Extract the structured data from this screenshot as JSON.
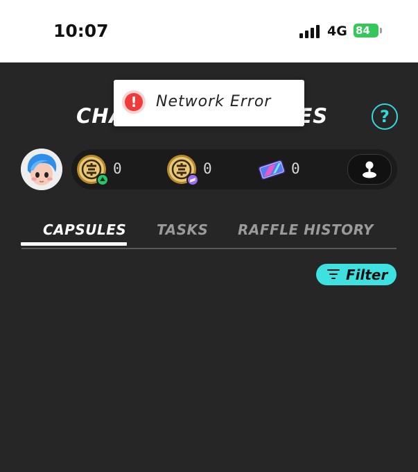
{
  "status_bar": {
    "time": "10:07",
    "network": "4G",
    "battery": "84",
    "battery_color": "#35c759"
  },
  "header": {
    "title": "CHAMPIONSHIP CAPSULES",
    "title_visible_left": "CHA",
    "title_visible_right": "LES",
    "help_label": "?"
  },
  "toast": {
    "icon": "error-icon",
    "icon_glyph": "!",
    "message": "Network Error"
  },
  "balances": [
    {
      "icon": "gold-coin-green-badge-icon",
      "value": "0"
    },
    {
      "icon": "gold-coin-purple-badge-icon",
      "value": "0"
    },
    {
      "icon": "ticket-card-icon",
      "value": "0"
    }
  ],
  "map_button_icon": "map-pin-icon",
  "tabs": [
    {
      "label": "CAPSULES",
      "active": true
    },
    {
      "label": "TASKS",
      "active": false
    },
    {
      "label": "RAFFLE HISTORY",
      "active": false
    }
  ],
  "filter": {
    "label": "Filter",
    "icon": "filter-lines-icon",
    "color": "#3ee0e0"
  },
  "colors": {
    "background": "#262626",
    "accent": "#34d9d9",
    "error": "#ef3b3b"
  }
}
